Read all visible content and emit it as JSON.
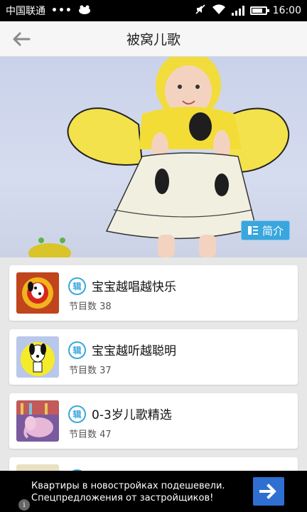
{
  "status_bar": {
    "carrier": "中国联通",
    "dots": "•••",
    "time": "16:00",
    "icons": [
      "notification-icon",
      "mute-icon",
      "wifi-icon",
      "signal-icon",
      "battery-icon"
    ],
    "battery_level": 0.75
  },
  "header": {
    "title": "被窝儿歌",
    "back_icon": "back-arrow-icon"
  },
  "hero": {
    "intro_label": "简介",
    "intro_icon": "list-icon"
  },
  "albums": [
    {
      "badge": "辑",
      "title": "宝宝越唱越快乐",
      "count_label": "节目数",
      "count": "38",
      "thumb": "dalmatian-red-icon"
    },
    {
      "badge": "辑",
      "title": "宝宝越听越聪明",
      "count_label": "节目数",
      "count": "37",
      "thumb": "dalmatian-yellow-icon"
    },
    {
      "badge": "辑",
      "title": "0-3岁儿歌精选",
      "count_label": "节目数",
      "count": "47",
      "thumb": "elephant-icon"
    },
    {
      "badge": "辑",
      "title": "",
      "count_label": "",
      "count": "",
      "thumb": "cartoon-icon"
    }
  ],
  "ad": {
    "line1": "Квартиры в новостройках подешевели.",
    "line2": "Спецпредложения от застройщиков!",
    "info": "i",
    "arrow_icon": "arrow-right-icon"
  },
  "colors": {
    "accent": "#3aa6de",
    "header_bg": "#f6f6f6",
    "ad_button": "#2f6fd1"
  }
}
